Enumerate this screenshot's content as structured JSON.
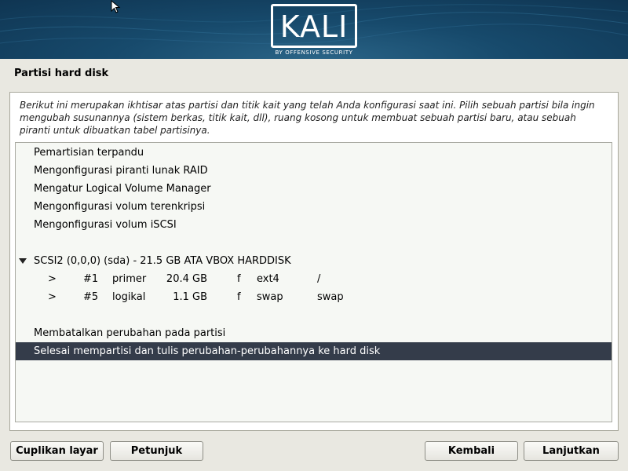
{
  "header": {
    "logo_text": "KALI",
    "logo_subtitle": "BY OFFENSIVE SECURITY"
  },
  "page_title": "Partisi hard disk",
  "description": "Berikut ini merupakan ikhtisar atas partisi dan titik kait yang telah Anda konfigurasi saat ini. Pilih sebuah partisi bila ingin mengubah susunannya (sistem berkas, titik kait, dll), ruang kosong untuk membuat sebuah partisi baru, atau sebuah piranti untuk dibuatkan tabel partisinya.",
  "menu_items": [
    "Pemartisian terpandu",
    "Mengonfigurasi piranti lunak RAID",
    "Mengatur Logical Volume Manager",
    "Mengonfigurasi volum terenkripsi",
    "Mengonfigurasi volum iSCSI"
  ],
  "disk": {
    "label": "SCSI2 (0,0,0) (sda) - 21.5 GB ATA VBOX HARDDISK",
    "partitions": [
      {
        "arrow": ">",
        "number": "#1",
        "type": "primer",
        "size": "20.4 GB",
        "flag": "f",
        "fs": "ext4",
        "mount": "/"
      },
      {
        "arrow": ">",
        "number": "#5",
        "type": "logikal",
        "size": "1.1 GB",
        "flag": "f",
        "fs": "swap",
        "mount": "swap"
      }
    ]
  },
  "actions": [
    "Membatalkan perubahan pada partisi",
    "Selesai mempartisi dan tulis perubahan-perubahannya ke hard disk"
  ],
  "selected_index": 1,
  "buttons": {
    "screenshot": "Cuplikan layar",
    "help": "Petunjuk",
    "back": "Kembali",
    "continue": "Lanjutkan"
  },
  "colors": {
    "header_bg": "#174a6c",
    "selection_bg": "#343c4a",
    "window_bg": "#e9e8e1"
  }
}
